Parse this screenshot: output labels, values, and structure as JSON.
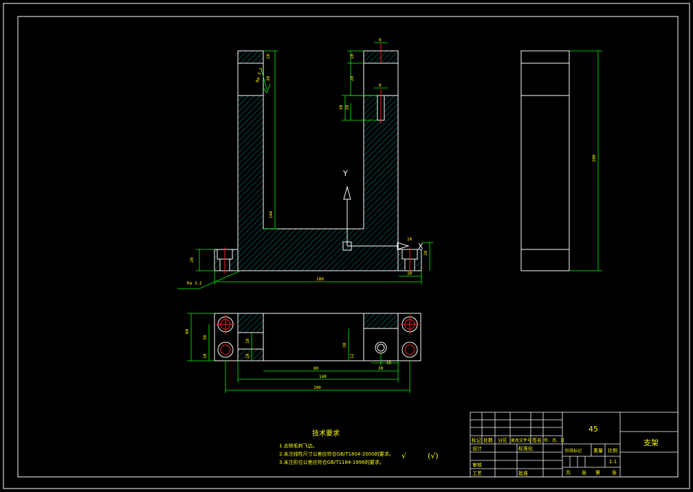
{
  "colors": {
    "background": "#000000",
    "outline": "#ffffff",
    "dimension": "#00ff00",
    "centerline": "#ff0000",
    "text": "#ffff00",
    "hatch": "#00cccc"
  },
  "front_view": {
    "dims": {
      "overall_width": "180",
      "inner_height": "144",
      "base_height": "20",
      "left_offset": "10",
      "right_offset": "10",
      "right_small": "20",
      "top_left_a": "10",
      "top_left_b": "30",
      "top_right_a": "10",
      "top_right_b": "20",
      "hole_a": "20",
      "hole_b": "30",
      "top_small": "6",
      "top_small2": "8"
    },
    "roughness_top": "Ra 3.2",
    "roughness_bottom": "Ra 3.2",
    "axis_y": "Y",
    "axis_x": "X"
  },
  "side_view": {
    "dims": {
      "height": "200"
    }
  },
  "top_view": {
    "dims": {
      "total_height": "60",
      "inner_a": "30",
      "inner_b": "10",
      "right_a": "30",
      "right_b": "12",
      "right_c": "15",
      "mid_span": "80",
      "right_span": "30",
      "span_140": "140",
      "span_200": "200",
      "left_small": "10",
      "left_small2": "10"
    }
  },
  "notes": {
    "title": "技术要求",
    "lines": [
      "1.去除毛刺飞边。",
      "2.未注线性尺寸公差应符合GB/T1804-2000的要求。",
      "3.未注形位公差应符合GB/T1184-1996的要求。"
    ]
  },
  "symbols": {
    "roughness_main": "√",
    "roughness_paren": "(√)"
  },
  "title_block": {
    "material": "45",
    "part_name": "支架",
    "scale": "1:1",
    "labels": {
      "mark": "标记",
      "count": "处数",
      "zone": "分区",
      "change_doc": "更改文件号",
      "signature": "签名",
      "date": "年、月、日",
      "design": "设计",
      "standardize": "标准化",
      "review": "审核",
      "process": "工艺",
      "approve": "批准",
      "stage_mark": "阶段标记",
      "weight": "重量",
      "ratio": "比例",
      "total": "共",
      "sheet_unit": "张",
      "page": "第",
      "page_unit": "张"
    }
  }
}
